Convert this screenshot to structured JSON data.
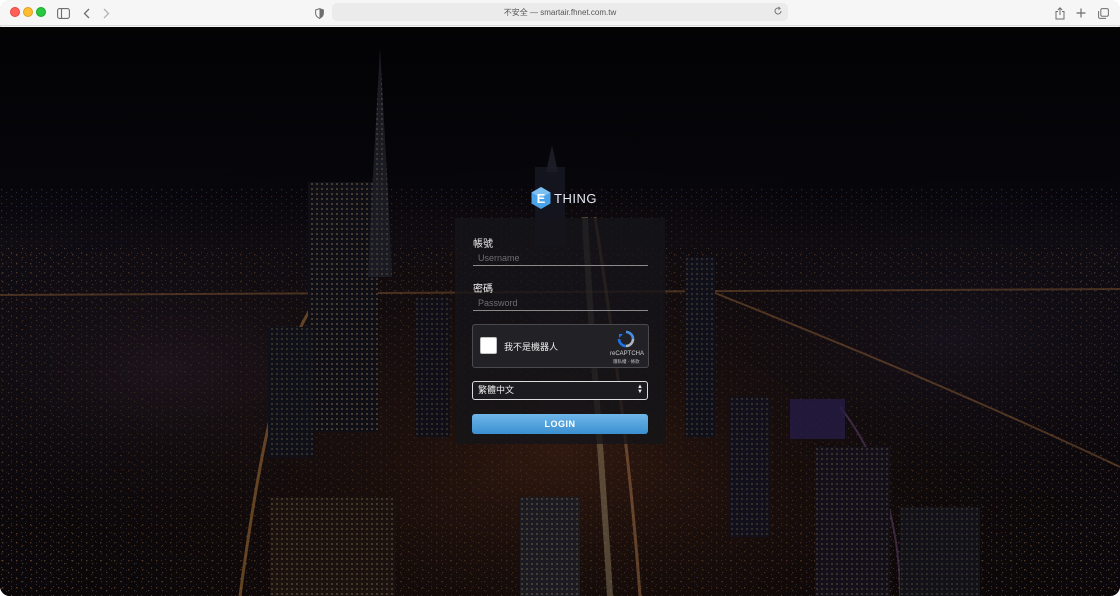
{
  "browser": {
    "address_text": "不安全 — smartair.fhnet.com.tw"
  },
  "brand": {
    "logo_letter": "E",
    "name": "THING",
    "accent_color": "#4aa3e8"
  },
  "login": {
    "username_label": "帳號",
    "username_placeholder": "Username",
    "password_label": "密碼",
    "password_placeholder": "Password",
    "recaptcha": {
      "label": "我不是機器人",
      "brand": "reCAPTCHA",
      "terms": "隱私權 - 條款"
    },
    "language": {
      "selected": "繁體中文"
    },
    "login_button": "LOGIN",
    "button_color": "#4a9cdc"
  },
  "icons": {
    "sidebar": "sidebar-icon",
    "back": "chevron-left-icon",
    "forward": "chevron-right-icon",
    "shield": "shield-icon",
    "reload": "reload-icon",
    "share": "share-icon",
    "new_tab": "plus-icon",
    "tabs": "tabs-overview-icon"
  }
}
